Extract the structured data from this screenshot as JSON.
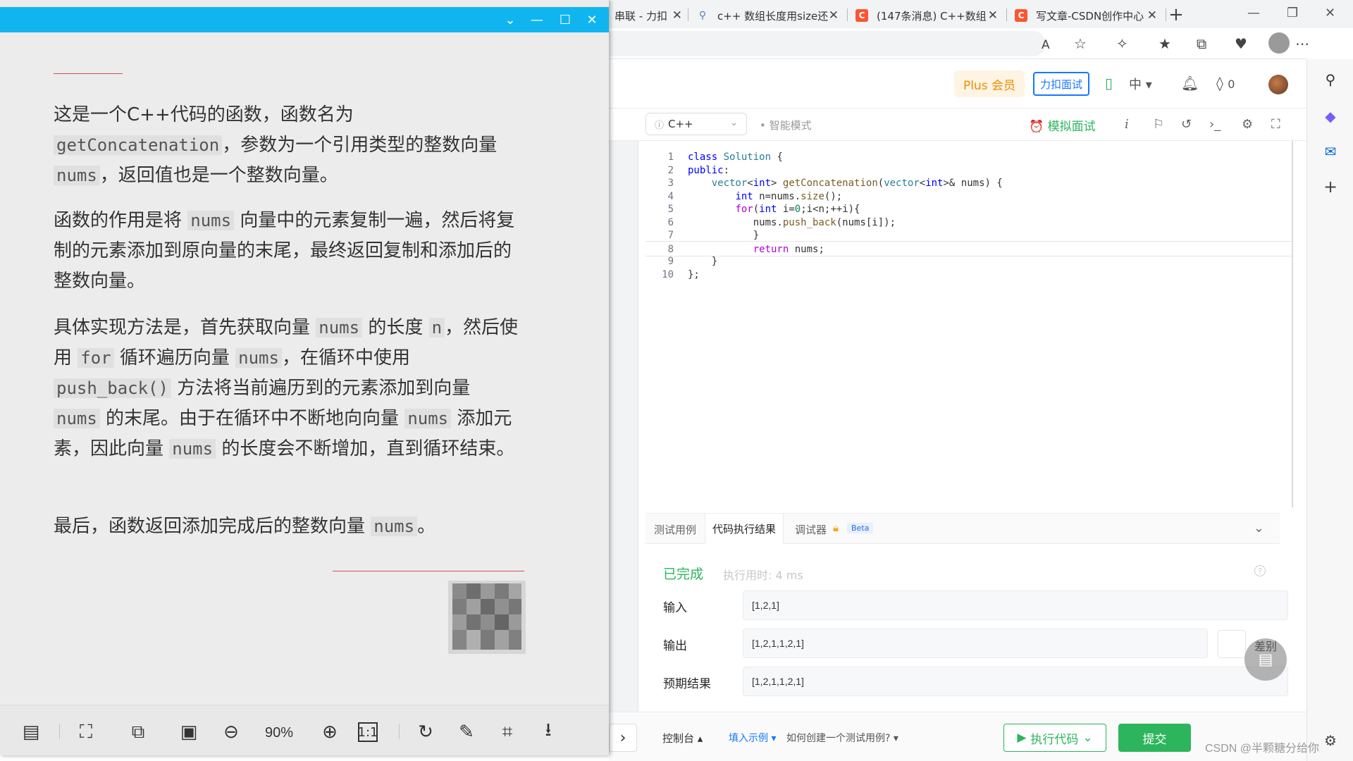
{
  "browser": {
    "tabs": [
      {
        "title": "串联 - 力扣",
        "icon_name": "leetcode-tab-icon"
      },
      {
        "title": "c++ 数组长度用size还",
        "icon_name": "search-tab-icon"
      },
      {
        "title": "(147条消息) C++数组",
        "icon_name": "csdn-tab-icon"
      },
      {
        "title": "写文章-CSDN创作中心",
        "icon_name": "csdn-tab-icon"
      }
    ],
    "new_tab": "+",
    "read_aloud": "A",
    "colors": {
      "csdn": "#fc5531",
      "tabstrip": "#f1f3f4"
    }
  },
  "leetcode": {
    "plus_label": "Plus 会员",
    "interview_label": "力扣面试",
    "lang_label": "中",
    "points": "0",
    "language": "C++",
    "smart_mode": "智能模式",
    "mock_interview": "模拟面试",
    "code_lines": [
      {
        "n": "1",
        "html": "<span class=\"kw\">class</span> <span class=\"ty\">Solution</span> {"
      },
      {
        "n": "2",
        "html": "<span class=\"kw\">public</span>:"
      },
      {
        "n": "3",
        "html": "    <span class=\"ty\">vector</span>&lt;<span class=\"kw\">int</span>&gt; <span class=\"fn\">getConcatenation</span>(<span class=\"ty\">vector</span>&lt;<span class=\"kw\">int</span>&gt;&amp; nums) {"
      },
      {
        "n": "4",
        "html": "        <span class=\"kw\">int</span> n=nums.<span class=\"fn\">size</span>();"
      },
      {
        "n": "5",
        "html": "        <span class=\"ctl\">for</span>(<span class=\"kw\">int</span> i=<span class=\"num\">0</span>;i&lt;n;++i){"
      },
      {
        "n": "6",
        "html": "           nums.<span class=\"fn\">push_back</span>(nums[i]);"
      },
      {
        "n": "7",
        "html": "           }"
      },
      {
        "n": "8",
        "html": "           <span class=\"ctl\">return</span> nums;"
      },
      {
        "n": "9",
        "html": "    }"
      },
      {
        "n": "10",
        "html": "};"
      }
    ],
    "result_tabs": {
      "testcase": "测试用例",
      "result": "代码执行结果",
      "debugger": "调试器",
      "beta": "Beta"
    },
    "status": "已完成",
    "exec_time": "执行用时: 4 ms",
    "input_label": "输入",
    "input_value": "[1,2,1]",
    "output_label": "输出",
    "output_value": "[1,2,1,1,2,1]",
    "expected_label": "预期结果",
    "expected_value": "[1,2,1,1,2,1]",
    "diff_label": "差别",
    "console_label": "控制台",
    "fill_example": "填入示例",
    "howto": "如何创建一个测试用例?",
    "run_label": "执行代码",
    "submit_label": "提交",
    "colors": {
      "green": "#2db55d",
      "blue": "#1677ff",
      "orange": "#ef8d00"
    }
  },
  "viewer": {
    "paragraphs": [
      "这是一个C++代码的函数，函数名为 <code>getConcatenation</code>，参数为一个引用类型的整数向量 <code>nums</code>，返回值也是一个整数向量。",
      "函数的作用是将 <code>nums</code> 向量中的元素复制一遍，然后将复制的元素添加到原向量的末尾，最终返回复制和添加后的整数向量。",
      "具体实现方法是，首先获取向量 <code>nums</code> 的长度 <code>n</code>，然后使用 <code>for</code> 循环遍历向量 <code>nums</code>，在循环中使用 <code>push_back()</code> 方法将当前遍历到的元素添加到向量 <code>nums</code> 的末尾。由于在循环中不断地向向量 <code>nums</code> 添加元素，因此向量 <code>nums</code> 的长度会不断增加，直到循环结束。",
      "最后，函数返回添加完成后的整数向量 <code>nums</code>。"
    ],
    "zoom": "90%",
    "title_color": "#10b5f0"
  },
  "watermark": "CSDN @半颗糖分给你"
}
